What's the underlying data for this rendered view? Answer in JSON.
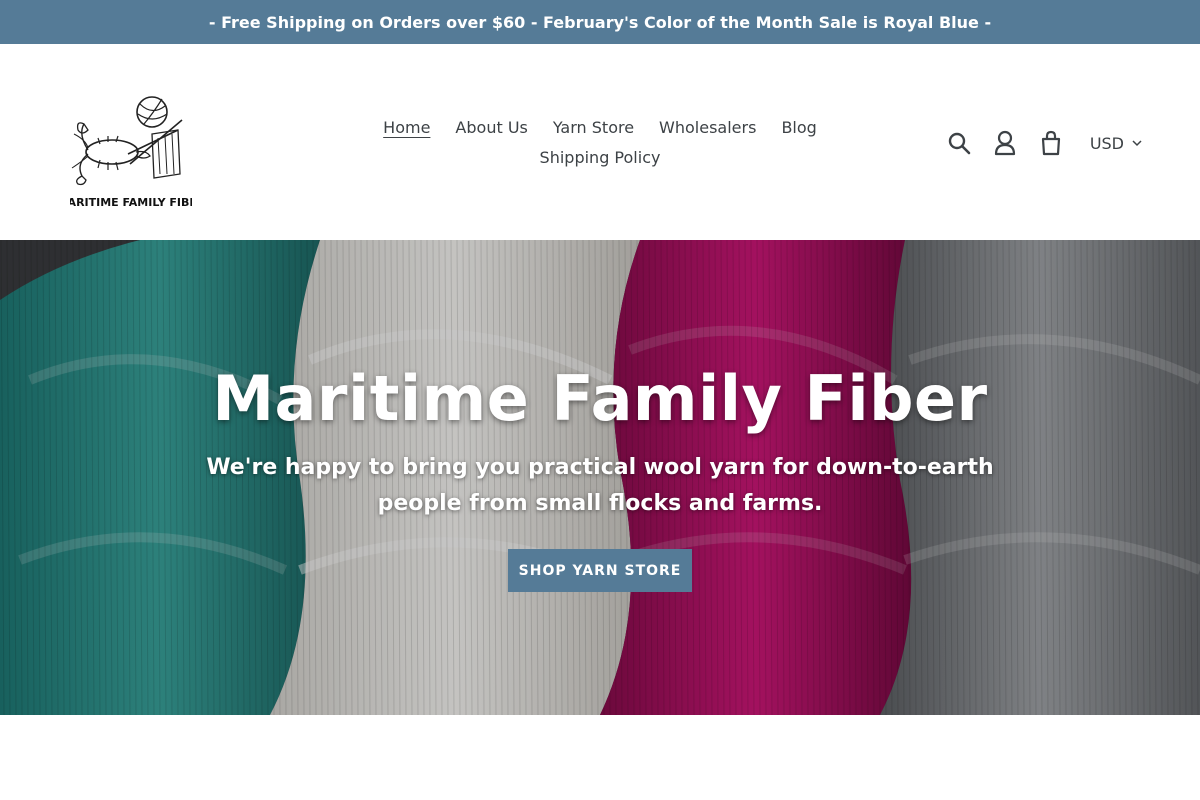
{
  "announcement": {
    "text": "- Free Shipping on Orders over $60 - February's Color of the Month Sale is Royal Blue -"
  },
  "logo": {
    "text": "MARITIME FAMILY FIBER",
    "icon": "lobster-yarn-logo-icon"
  },
  "nav": {
    "items": [
      {
        "label": "Home",
        "active": true
      },
      {
        "label": "About Us"
      },
      {
        "label": "Yarn Store"
      },
      {
        "label": "Wholesalers"
      },
      {
        "label": "Blog"
      },
      {
        "label": "Shipping Policy"
      }
    ]
  },
  "utilities": {
    "search_icon": "search-icon",
    "account_icon": "account-icon",
    "cart_icon": "cart-icon",
    "currency": "USD"
  },
  "hero": {
    "title": "Maritime Family Fiber",
    "subtitle": "We're happy to bring you practical wool yarn for down-to-earth people from small flocks and farms.",
    "button_label": "SHOP YARN STORE"
  },
  "colors": {
    "accent": "#557b97",
    "teal_yarn": "#2f9a94",
    "white_yarn": "#f2f1ee",
    "magenta_yarn": "#c4136e",
    "gray_yarn": "#8c8f93"
  }
}
